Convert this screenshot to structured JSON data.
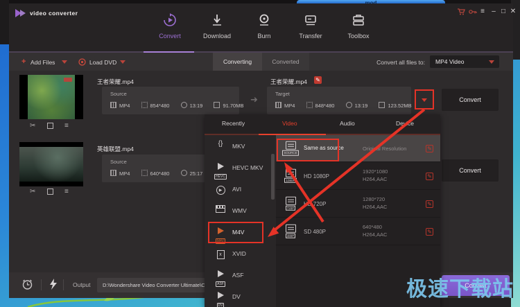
{
  "desktop": {
    "background_window_title": "mod",
    "watermark": "极速下载站"
  },
  "titlebar": {
    "app_title": "video converter",
    "menu_glyph": "≡",
    "minimize_glyph": "–",
    "maximize_glyph": "□",
    "close_glyph": "✕"
  },
  "nav": {
    "items": [
      {
        "label": "Convert",
        "active": true
      },
      {
        "label": "Download"
      },
      {
        "label": "Burn"
      },
      {
        "label": "Transfer"
      },
      {
        "label": "Toolbox"
      }
    ]
  },
  "toolbar": {
    "add_files_label": "Add Files",
    "add_files_plus": "+",
    "load_dvd_label": "Load DVD",
    "tab_converting": "Converting",
    "tab_converted": "Converted",
    "convert_all_label": "Convert all files to:",
    "convert_all_value": "MP4 Video"
  },
  "files": [
    {
      "name": "王者荣耀.mp4",
      "source": {
        "label": "Source",
        "format": "MP4",
        "resolution": "854*480",
        "duration": "13:19",
        "size": "91.70MB"
      },
      "target": {
        "label": "Target",
        "name": "王者荣耀.mp4",
        "format": "MP4",
        "resolution": "848*480",
        "duration": "13:19",
        "size": "123.52MB"
      },
      "convert_label": "Convert"
    },
    {
      "name": "英雄联盟.mp4",
      "source": {
        "label": "Source",
        "format": "MP4",
        "resolution": "640*480",
        "duration": "25:17"
      },
      "convert_label": "Convert"
    }
  ],
  "format_panel": {
    "tabs": [
      {
        "label": "Recently"
      },
      {
        "label": "Video",
        "active": true
      },
      {
        "label": "Audio"
      },
      {
        "label": "Device"
      }
    ],
    "formats": [
      {
        "label": "MKV",
        "glyph": "{}"
      },
      {
        "label": "HEVC MKV",
        "badge": "HEVC"
      },
      {
        "label": "AVI",
        "glyph": "▶"
      },
      {
        "label": "WMV"
      },
      {
        "label": "M4V",
        "badge": "M4V",
        "selected": true
      },
      {
        "label": "XVID",
        "glyph": "x"
      },
      {
        "label": "ASF",
        "badge": "ASF"
      },
      {
        "label": "DV",
        "badge": "DV"
      }
    ],
    "presets": [
      {
        "label": "Same as source",
        "detail": "Original Resolution",
        "badge": "SOURCE",
        "highlighted": true
      },
      {
        "label": "HD 1080P",
        "resolution": "1920*1080",
        "codec": "H264,AAC",
        "badge": "1080P"
      },
      {
        "label": "HD 720P",
        "resolution": "1280*720",
        "codec": "H264,AAC",
        "badge": "720P"
      },
      {
        "label": "SD 480P",
        "resolution": "640*480",
        "codec": "H264,AAC",
        "badge": "480P"
      }
    ]
  },
  "bottom_bar": {
    "output_label": "Output",
    "output_path": "D:\\Wondershare Video Converter Ultimate\\Conve",
    "convert_all_button": "Convert"
  },
  "colors": {
    "accent_purple": "#8d65c5",
    "accent_red": "#e8382d",
    "desktop_blue": "#2b87d8",
    "desktop_teal": "#3fb3cf",
    "panel_highlight": "#494545"
  }
}
